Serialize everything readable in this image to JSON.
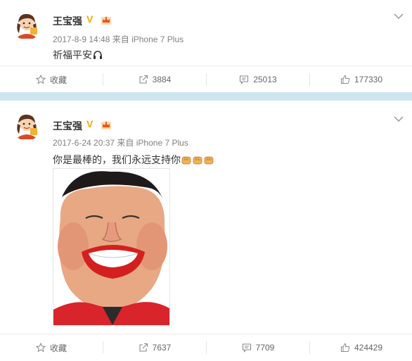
{
  "colors": {
    "verified": "#f6a800",
    "separator": "#cde6ee",
    "meta": "#808080"
  },
  "posts": [
    {
      "author": "王宝强",
      "verified_mark": "V",
      "time": "2017-8-9 14:48",
      "source": "来自 iPhone 7 Plus",
      "text": "祈福平安",
      "emojis": [
        "headphone-emoji"
      ],
      "actions": {
        "favorite": "收藏",
        "repost": "3884",
        "comment": "25013",
        "like": "177330"
      }
    },
    {
      "author": "王宝强",
      "verified_mark": "V",
      "time": "2017-6-24 20:37",
      "source": "来自 iPhone 7 Plus",
      "text": "你是最棒的，我们永远支持你",
      "emojis": [
        "fist-emoji",
        "fist-emoji",
        "fist-emoji"
      ],
      "image": "caricature-photo",
      "actions": {
        "favorite": "收藏",
        "repost": "7637",
        "comment": "7709",
        "like": "424429"
      }
    }
  ]
}
